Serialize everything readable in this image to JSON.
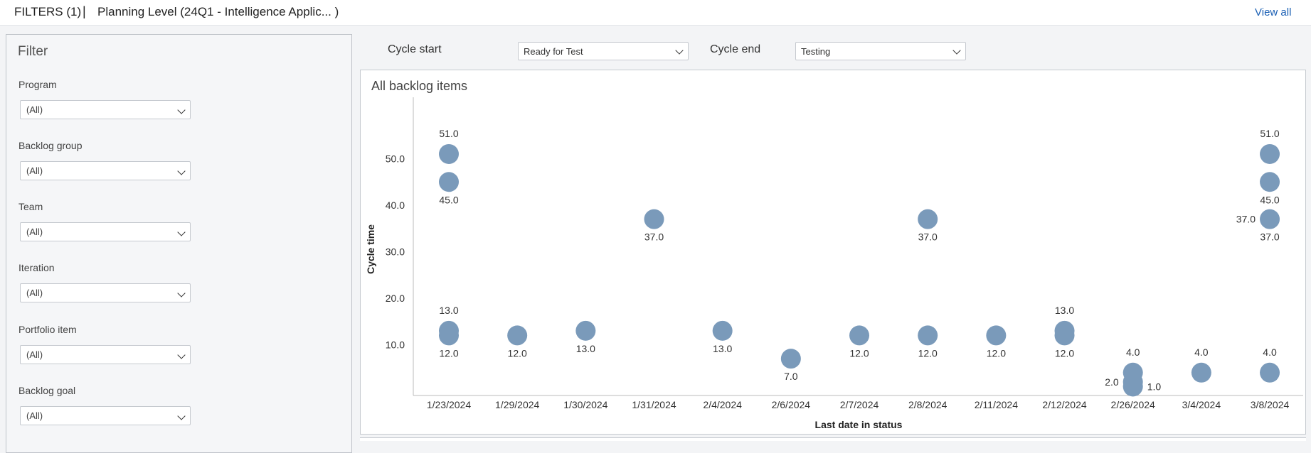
{
  "topbar": {
    "filters_label": "FILTERS (1)",
    "separator": "|",
    "planning_label": "Planning Level  (24Q1 - Intelligence Applic... )",
    "view_all": "View all"
  },
  "filter_panel": {
    "title": "Filter",
    "groups": [
      {
        "label": "Program",
        "value": "(All)"
      },
      {
        "label": "Backlog group",
        "value": "(All)"
      },
      {
        "label": "Team",
        "value": "(All)"
      },
      {
        "label": "Iteration",
        "value": "(All)"
      },
      {
        "label": "Portfolio item",
        "value": "(All)"
      },
      {
        "label": "Backlog goal",
        "value": "(All)"
      }
    ]
  },
  "cycle": {
    "start_label": "Cycle start",
    "start_value": "Ready for Test",
    "end_label": "Cycle end",
    "end_value": "Testing"
  },
  "chart_data": {
    "type": "scatter",
    "title": "All backlog items",
    "xlabel": "Last date in status",
    "ylabel": "Cycle time",
    "categories": [
      "1/23/2024",
      "1/29/2024",
      "1/30/2024",
      "1/31/2024",
      "2/4/2024",
      "2/6/2024",
      "2/7/2024",
      "2/8/2024",
      "2/11/2024",
      "2/12/2024",
      "2/26/2024",
      "3/4/2024",
      "3/8/2024"
    ],
    "yticks": [
      "10.0",
      "20.0",
      "30.0",
      "40.0",
      "50.0"
    ],
    "ylim": [
      -1,
      57
    ],
    "grid": false,
    "point_color": "#7a9aba",
    "points": [
      {
        "x": "1/23/2024",
        "y": 51,
        "label": "51.0",
        "pos": "above"
      },
      {
        "x": "1/23/2024",
        "y": 45,
        "label": "45.0",
        "pos": "below"
      },
      {
        "x": "1/23/2024",
        "y": 13,
        "label": "13.0",
        "pos": "above"
      },
      {
        "x": "1/23/2024",
        "y": 12,
        "label": "12.0",
        "pos": "below"
      },
      {
        "x": "1/29/2024",
        "y": 12,
        "label": "12.0",
        "pos": "below"
      },
      {
        "x": "1/30/2024",
        "y": 13,
        "label": "13.0",
        "pos": "below"
      },
      {
        "x": "1/31/2024",
        "y": 37,
        "label": "37.0",
        "pos": "below"
      },
      {
        "x": "2/4/2024",
        "y": 13,
        "label": "13.0",
        "pos": "below"
      },
      {
        "x": "2/6/2024",
        "y": 7,
        "label": "7.0",
        "pos": "below"
      },
      {
        "x": "2/7/2024",
        "y": 12,
        "label": "12.0",
        "pos": "below"
      },
      {
        "x": "2/8/2024",
        "y": 37,
        "label": "37.0",
        "pos": "below"
      },
      {
        "x": "2/8/2024",
        "y": 12,
        "label": "12.0",
        "pos": "below"
      },
      {
        "x": "2/11/2024",
        "y": 12,
        "label": "12.0",
        "pos": "below"
      },
      {
        "x": "2/12/2024",
        "y": 13,
        "label": "13.0",
        "pos": "above"
      },
      {
        "x": "2/12/2024",
        "y": 12,
        "label": "12.0",
        "pos": "below"
      },
      {
        "x": "2/26/2024",
        "y": 4,
        "label": "4.0",
        "pos": "above"
      },
      {
        "x": "2/26/2024",
        "y": 2,
        "label": "2.0",
        "pos": "left"
      },
      {
        "x": "2/26/2024",
        "y": 1,
        "label": "1.0",
        "pos": "right"
      },
      {
        "x": "3/4/2024",
        "y": 4,
        "label": "4.0",
        "pos": "above"
      },
      {
        "x": "3/8/2024",
        "y": 51,
        "label": "51.0",
        "pos": "above"
      },
      {
        "x": "3/8/2024",
        "y": 45,
        "label": "45.0",
        "pos": "below"
      },
      {
        "x": "3/8/2024",
        "y": 37,
        "label": "37.0",
        "pos": "left"
      },
      {
        "x": "3/8/2024",
        "y": 37,
        "label": "37.0",
        "pos": "below"
      },
      {
        "x": "3/8/2024",
        "y": 4,
        "label": "4.0",
        "pos": "above"
      }
    ]
  }
}
